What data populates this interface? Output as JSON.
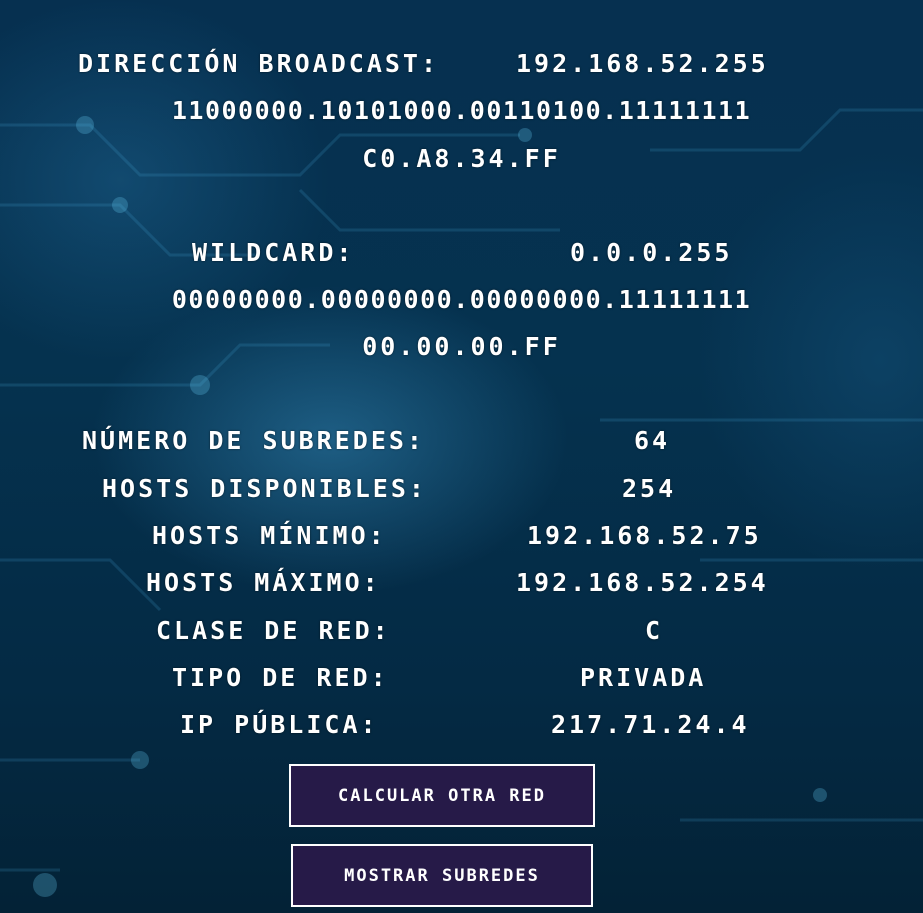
{
  "broadcast": {
    "label": "DIRECCIÓN BROADCAST:",
    "value": "192.168.52.255",
    "binary": "11000000.10101000.00110100.11111111",
    "hex": "C0.A8.34.FF"
  },
  "wildcard": {
    "label": "WILDCARD:",
    "value": "0.0.0.255",
    "binary": "00000000.00000000.00000000.11111111",
    "hex": "00.00.00.FF"
  },
  "details": [
    {
      "label": "NÚMERO DE SUBREDES:",
      "value": "64"
    },
    {
      "label": "HOSTS DISPONIBLES:",
      "value": "254"
    },
    {
      "label": "HOSTS MÍNIMO:",
      "value": "192.168.52.75"
    },
    {
      "label": "HOSTS MÁXIMO:",
      "value": "192.168.52.254"
    },
    {
      "label": "CLASE DE RED:",
      "value": "C"
    },
    {
      "label": "TIPO DE RED:",
      "value": "PRIVADA"
    },
    {
      "label": "IP PÚBLICA:",
      "value": "217.71.24.4"
    }
  ],
  "buttons": {
    "calculate_label": "CALCULAR OTRA RED",
    "show_subnets_label": "MOSTRAR SUBREDES"
  },
  "colors": {
    "background": "#07304a",
    "button_fill": "#261a48",
    "text": "#ffffff"
  }
}
